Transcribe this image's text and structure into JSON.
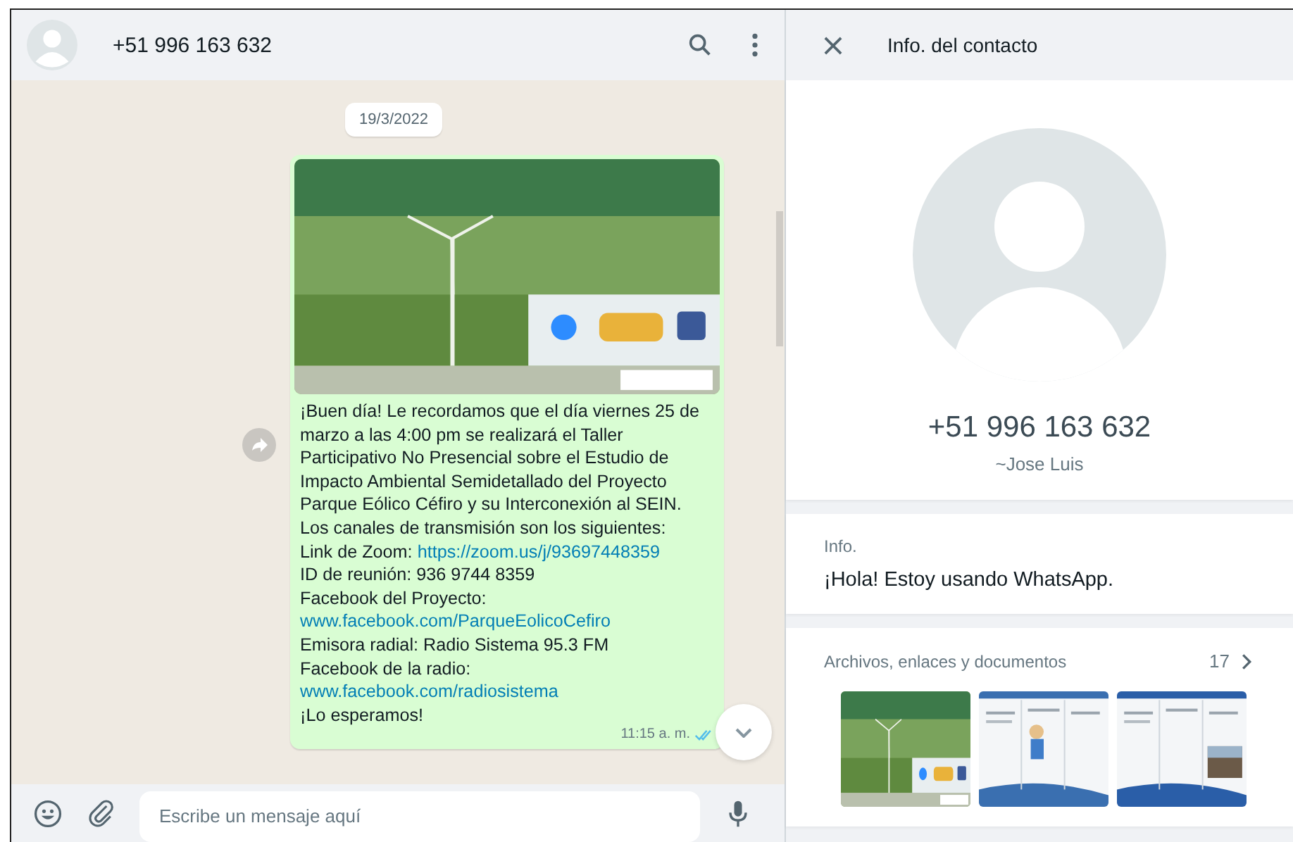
{
  "chat_header": {
    "title": "+51 996 163 632"
  },
  "date_chip": "19/3/2022",
  "message": {
    "image": {
      "kind": "picture"
    },
    "lines": [
      [
        {
          "kind": "text",
          "text": "¡Buen día! Le recordamos que el día viernes 25 de marzo a las 4:00 pm se realizará el Taller Participativo No Presencial sobre el Estudio de Impacto Ambiental Semidetallado del Proyecto Parque Eólico Céfiro y su Interconexión al SEIN."
        }
      ],
      [
        {
          "kind": "text",
          "text": "Los canales de transmisión son los siguientes:"
        }
      ],
      [
        {
          "kind": "text",
          "text": "Link de Zoom: "
        },
        {
          "kind": "link",
          "text": "https://zoom.us/j/93697448359"
        }
      ],
      [
        {
          "kind": "text",
          "text": "ID de reunión: 936 9744 8359"
        }
      ],
      [
        {
          "kind": "text",
          "text": "Facebook del Proyecto:"
        }
      ],
      [
        {
          "kind": "link",
          "text": "www.facebook.com/ParqueEolicoCefiro"
        }
      ],
      [
        {
          "kind": "text",
          "text": "Emisora radial: Radio Sistema 95.3 FM"
        }
      ],
      [
        {
          "kind": "text",
          "text": "Facebook de la radio:"
        }
      ],
      [
        {
          "kind": "link",
          "text": "www.facebook.com/radiosistema"
        }
      ],
      [
        {
          "kind": "text",
          "text": "¡Lo esperamos!"
        }
      ]
    ],
    "time": "11:15 a. m.",
    "read": true
  },
  "composer": {
    "placeholder": "Escribe un mensaje aquí"
  },
  "contact_panel": {
    "title": "Info. del contacto",
    "phone": "+51 996 163 632",
    "name": "~Jose Luis",
    "about_label": "Info.",
    "about": "¡Hola! Estoy usando WhatsApp.",
    "media_label": "Archivos, enlaces y documentos",
    "media_count": "17",
    "media": [
      {
        "kind": "picture"
      },
      {
        "kind": "picture"
      },
      {
        "kind": "picture"
      }
    ]
  }
}
